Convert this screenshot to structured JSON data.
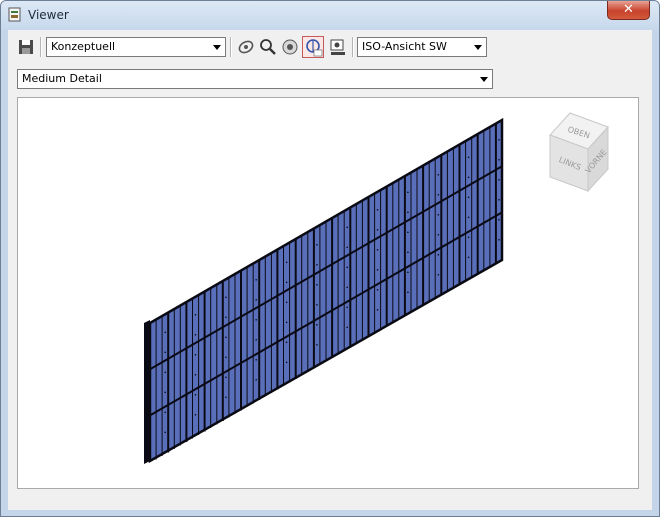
{
  "window": {
    "title": "Viewer",
    "close_symbol": "✕"
  },
  "toolbar": {
    "style_select": {
      "value": "Konzeptuell"
    },
    "view_select": {
      "value": "ISO-Ansicht SW"
    },
    "tools": [
      "save-icon",
      "orbit-icon",
      "zoom-icon",
      "zoom-fit-icon",
      "steering-wheel-icon",
      "view-settings-icon"
    ]
  },
  "detail_select": {
    "value": "Medium Detail"
  },
  "viewcube": {
    "top": "OBEN",
    "left": "LINKS",
    "front": "VORNE"
  },
  "colors": {
    "wall_face": "#5a6fba",
    "wall_edge": "#0a0a14",
    "window_bg": "#c4d5ea",
    "accent": "#1f5fa8"
  }
}
